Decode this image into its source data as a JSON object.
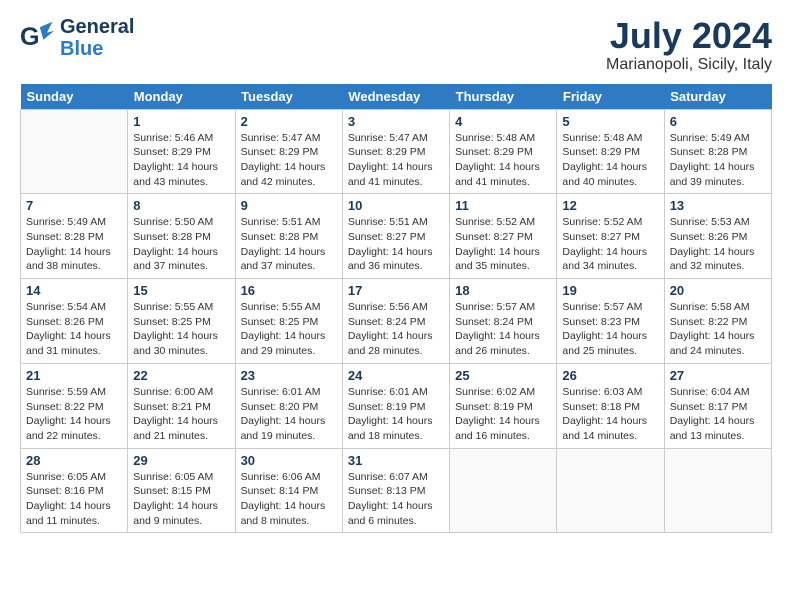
{
  "header": {
    "logo_general": "General",
    "logo_blue": "Blue",
    "month_year": "July 2024",
    "location": "Marianopoli, Sicily, Italy"
  },
  "days_of_week": [
    "Sunday",
    "Monday",
    "Tuesday",
    "Wednesday",
    "Thursday",
    "Friday",
    "Saturday"
  ],
  "weeks": [
    [
      {
        "day": "",
        "info": ""
      },
      {
        "day": "1",
        "info": "Sunrise: 5:46 AM\nSunset: 8:29 PM\nDaylight: 14 hours\nand 43 minutes."
      },
      {
        "day": "2",
        "info": "Sunrise: 5:47 AM\nSunset: 8:29 PM\nDaylight: 14 hours\nand 42 minutes."
      },
      {
        "day": "3",
        "info": "Sunrise: 5:47 AM\nSunset: 8:29 PM\nDaylight: 14 hours\nand 41 minutes."
      },
      {
        "day": "4",
        "info": "Sunrise: 5:48 AM\nSunset: 8:29 PM\nDaylight: 14 hours\nand 41 minutes."
      },
      {
        "day": "5",
        "info": "Sunrise: 5:48 AM\nSunset: 8:29 PM\nDaylight: 14 hours\nand 40 minutes."
      },
      {
        "day": "6",
        "info": "Sunrise: 5:49 AM\nSunset: 8:28 PM\nDaylight: 14 hours\nand 39 minutes."
      }
    ],
    [
      {
        "day": "7",
        "info": "Sunrise: 5:49 AM\nSunset: 8:28 PM\nDaylight: 14 hours\nand 38 minutes."
      },
      {
        "day": "8",
        "info": "Sunrise: 5:50 AM\nSunset: 8:28 PM\nDaylight: 14 hours\nand 37 minutes."
      },
      {
        "day": "9",
        "info": "Sunrise: 5:51 AM\nSunset: 8:28 PM\nDaylight: 14 hours\nand 37 minutes."
      },
      {
        "day": "10",
        "info": "Sunrise: 5:51 AM\nSunset: 8:27 PM\nDaylight: 14 hours\nand 36 minutes."
      },
      {
        "day": "11",
        "info": "Sunrise: 5:52 AM\nSunset: 8:27 PM\nDaylight: 14 hours\nand 35 minutes."
      },
      {
        "day": "12",
        "info": "Sunrise: 5:52 AM\nSunset: 8:27 PM\nDaylight: 14 hours\nand 34 minutes."
      },
      {
        "day": "13",
        "info": "Sunrise: 5:53 AM\nSunset: 8:26 PM\nDaylight: 14 hours\nand 32 minutes."
      }
    ],
    [
      {
        "day": "14",
        "info": "Sunrise: 5:54 AM\nSunset: 8:26 PM\nDaylight: 14 hours\nand 31 minutes."
      },
      {
        "day": "15",
        "info": "Sunrise: 5:55 AM\nSunset: 8:25 PM\nDaylight: 14 hours\nand 30 minutes."
      },
      {
        "day": "16",
        "info": "Sunrise: 5:55 AM\nSunset: 8:25 PM\nDaylight: 14 hours\nand 29 minutes."
      },
      {
        "day": "17",
        "info": "Sunrise: 5:56 AM\nSunset: 8:24 PM\nDaylight: 14 hours\nand 28 minutes."
      },
      {
        "day": "18",
        "info": "Sunrise: 5:57 AM\nSunset: 8:24 PM\nDaylight: 14 hours\nand 26 minutes."
      },
      {
        "day": "19",
        "info": "Sunrise: 5:57 AM\nSunset: 8:23 PM\nDaylight: 14 hours\nand 25 minutes."
      },
      {
        "day": "20",
        "info": "Sunrise: 5:58 AM\nSunset: 8:22 PM\nDaylight: 14 hours\nand 24 minutes."
      }
    ],
    [
      {
        "day": "21",
        "info": "Sunrise: 5:59 AM\nSunset: 8:22 PM\nDaylight: 14 hours\nand 22 minutes."
      },
      {
        "day": "22",
        "info": "Sunrise: 6:00 AM\nSunset: 8:21 PM\nDaylight: 14 hours\nand 21 minutes."
      },
      {
        "day": "23",
        "info": "Sunrise: 6:01 AM\nSunset: 8:20 PM\nDaylight: 14 hours\nand 19 minutes."
      },
      {
        "day": "24",
        "info": "Sunrise: 6:01 AM\nSunset: 8:19 PM\nDaylight: 14 hours\nand 18 minutes."
      },
      {
        "day": "25",
        "info": "Sunrise: 6:02 AM\nSunset: 8:19 PM\nDaylight: 14 hours\nand 16 minutes."
      },
      {
        "day": "26",
        "info": "Sunrise: 6:03 AM\nSunset: 8:18 PM\nDaylight: 14 hours\nand 14 minutes."
      },
      {
        "day": "27",
        "info": "Sunrise: 6:04 AM\nSunset: 8:17 PM\nDaylight: 14 hours\nand 13 minutes."
      }
    ],
    [
      {
        "day": "28",
        "info": "Sunrise: 6:05 AM\nSunset: 8:16 PM\nDaylight: 14 hours\nand 11 minutes."
      },
      {
        "day": "29",
        "info": "Sunrise: 6:05 AM\nSunset: 8:15 PM\nDaylight: 14 hours\nand 9 minutes."
      },
      {
        "day": "30",
        "info": "Sunrise: 6:06 AM\nSunset: 8:14 PM\nDaylight: 14 hours\nand 8 minutes."
      },
      {
        "day": "31",
        "info": "Sunrise: 6:07 AM\nSunset: 8:13 PM\nDaylight: 14 hours\nand 6 minutes."
      },
      {
        "day": "",
        "info": ""
      },
      {
        "day": "",
        "info": ""
      },
      {
        "day": "",
        "info": ""
      }
    ]
  ]
}
